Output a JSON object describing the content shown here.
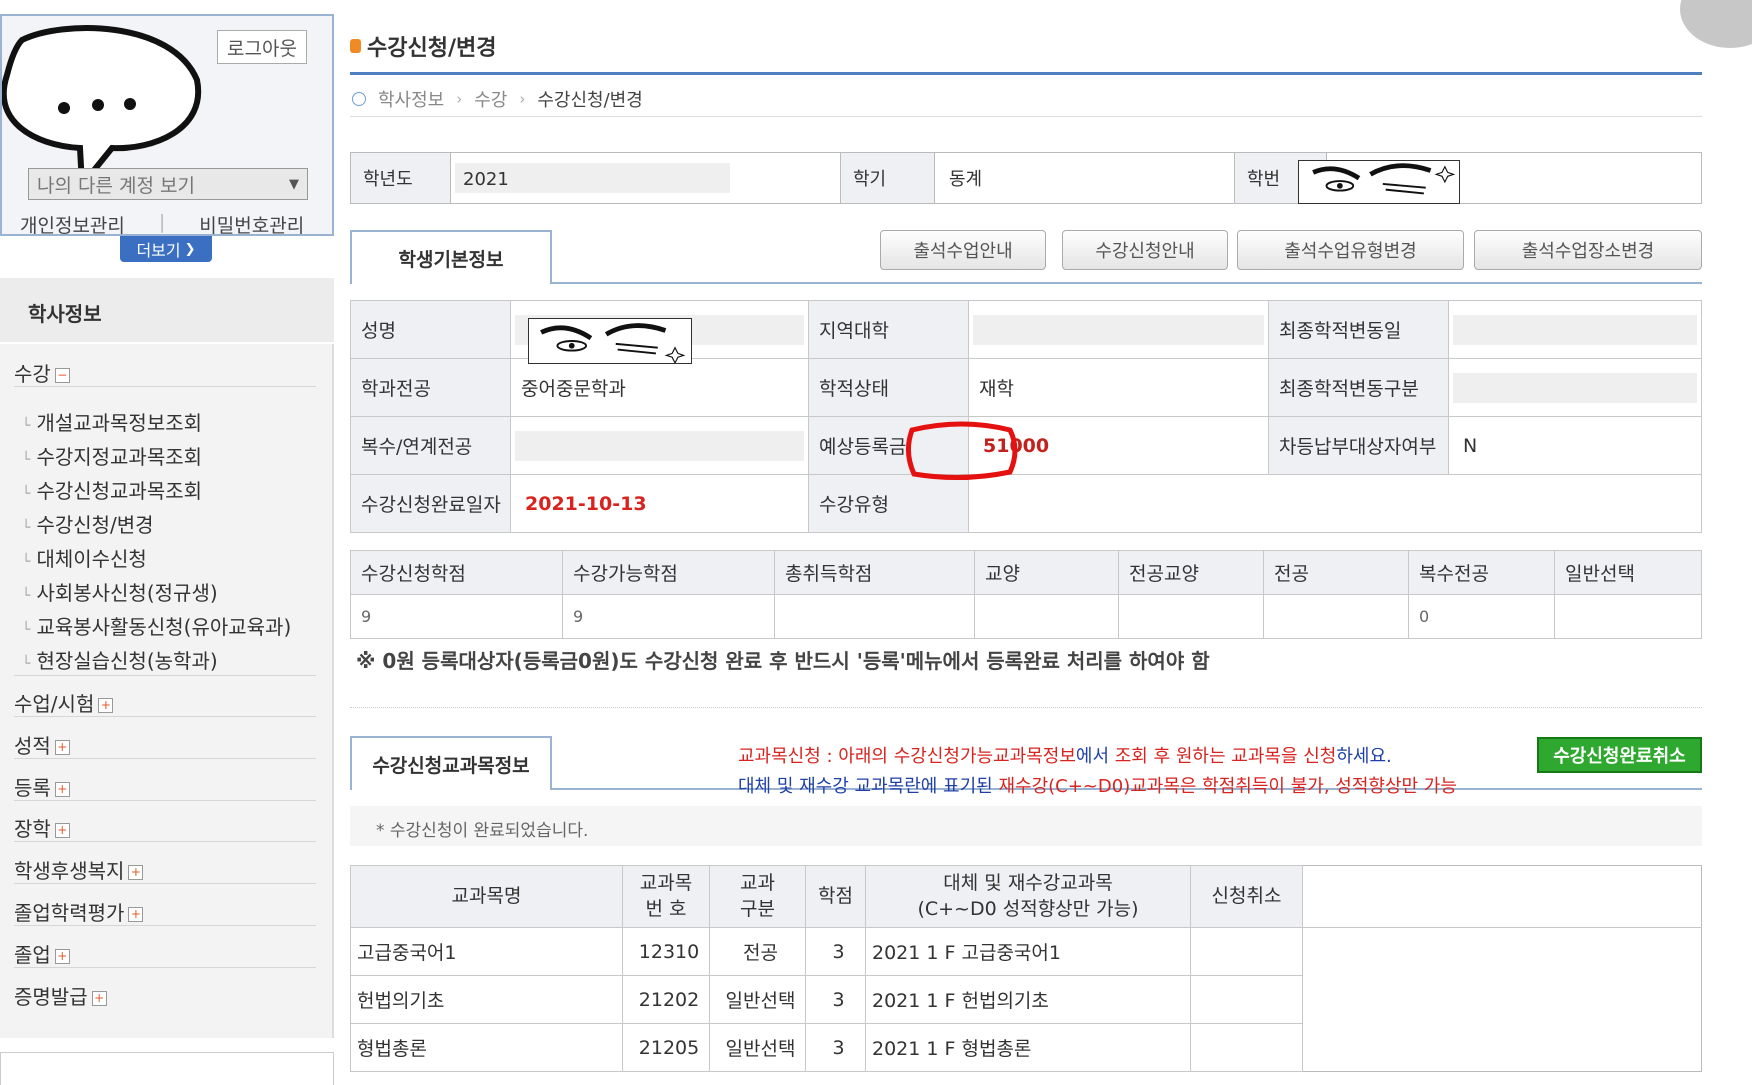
{
  "profile": {
    "logout_label": "로그아웃",
    "account_select": "나의 다른 계정 보기",
    "personal_info": "개인정보관리",
    "password": "비밀번호관리",
    "more": "더보기"
  },
  "sidebar": {
    "title": "학사정보",
    "sections": [
      {
        "label": "수강",
        "toggle": "−"
      },
      {
        "label": "수업/시험",
        "toggle": "+"
      },
      {
        "label": "성적",
        "toggle": "+"
      },
      {
        "label": "등록",
        "toggle": "+"
      },
      {
        "label": "장학",
        "toggle": "+"
      },
      {
        "label": "학생후생복지",
        "toggle": "+"
      },
      {
        "label": "졸업학력평가",
        "toggle": "+"
      },
      {
        "label": "졸업",
        "toggle": "+"
      },
      {
        "label": "증명발급",
        "toggle": "+"
      }
    ],
    "sub_items": [
      "개설교과목정보조회",
      "수강지정교과목조회",
      "수강신청교과목조회",
      "수강신청/변경",
      "대체이수신청",
      "사회봉사신청(정규생)",
      "교육봉사활동신청(유아교육과)",
      "현장실습신청(농학과)"
    ]
  },
  "page": {
    "title": "수강신청/변경",
    "breadcrumb": [
      "학사정보",
      "수강",
      "수강신청/변경"
    ]
  },
  "basic": {
    "year_label": "학년도",
    "year_value": "2021",
    "semester_label": "학기",
    "semester_value": "동계",
    "student_no_label": "학번"
  },
  "tabs": {
    "student_info": "학생기본정보",
    "course_info": "수강신청교과목정보"
  },
  "buttons": {
    "attendance_guide": "출석수업안내",
    "registration_guide": "수강신청안내",
    "attendance_type_change": "출석수업유형변경",
    "attendance_place_change": "출석수업장소변경",
    "cancel_completion": "수강신청완료취소"
  },
  "student": {
    "name_label": "성명",
    "region_label": "지역대학",
    "last_change_date_label": "최종학적변동일",
    "major_label": "학과전공",
    "major_value": "중어중문학과",
    "status_label": "학적상태",
    "status_value": "재학",
    "last_change_type_label": "최종학적변동구분",
    "double_major_label": "복수/연계전공",
    "expected_fee_label": "예상등록금",
    "expected_fee_value": "51000",
    "diff_pay_label": "차등납부대상자여부",
    "diff_pay_value": "N",
    "complete_date_label": "수강신청완료일자",
    "complete_date_value": "2021-10-13",
    "course_type_label": "수강유형"
  },
  "credits": {
    "headers": [
      "수강신청학점",
      "수강가능학점",
      "총취득학점",
      "교양",
      "전공교양",
      "전공",
      "복수전공",
      "일반선택"
    ],
    "values": [
      "9",
      "9",
      "",
      "",
      "",
      "",
      "0",
      ""
    ]
  },
  "notice": "※ 0원 등록대상자(등록금0원)도 수강신청 완료 후 반드시 '등록'메뉴에서 등록완료 처리를 하여야 함",
  "guide": {
    "line1_parts": [
      "교과목신청 : 아래의 ",
      "수강신청가능교과목정보",
      "에서 ",
      "조회 후 원하는 교과목을 신청",
      "하세요."
    ],
    "line2_parts": [
      "대체 및 재수강 교과목란에 표기된 ",
      "재수강(C+~D0)교과목은 학점취득이 불가, 성적향상만 가능"
    ]
  },
  "done_message": "* 수강신청이 완료되었습니다.",
  "courses": {
    "headers": {
      "name": "교과목명",
      "code_1": "교과목",
      "code_2": "번 호",
      "type_1": "교과",
      "type_2": "구분",
      "credit": "학점",
      "retake_1": "대체 및 재수강교과목",
      "retake_2": "(C+~D0 성적향상만 가능)",
      "cancel": "신청취소"
    },
    "rows": [
      {
        "name": "고급중국어1",
        "code": "12310",
        "type": "전공",
        "credit": "3",
        "retake": "2021 1 F 고급중국어1"
      },
      {
        "name": "헌법의기초",
        "code": "21202",
        "type": "일반선택",
        "credit": "3",
        "retake": "2021 1 F 헌법의기초"
      },
      {
        "name": "형법총론",
        "code": "21205",
        "type": "일반선택",
        "credit": "3",
        "retake": "2021 1 F 형법총론"
      }
    ]
  },
  "colors": {
    "accent_blue": "#4e7fc0",
    "highlight_red": "#d8231f",
    "green_button": "#2ea82e"
  }
}
